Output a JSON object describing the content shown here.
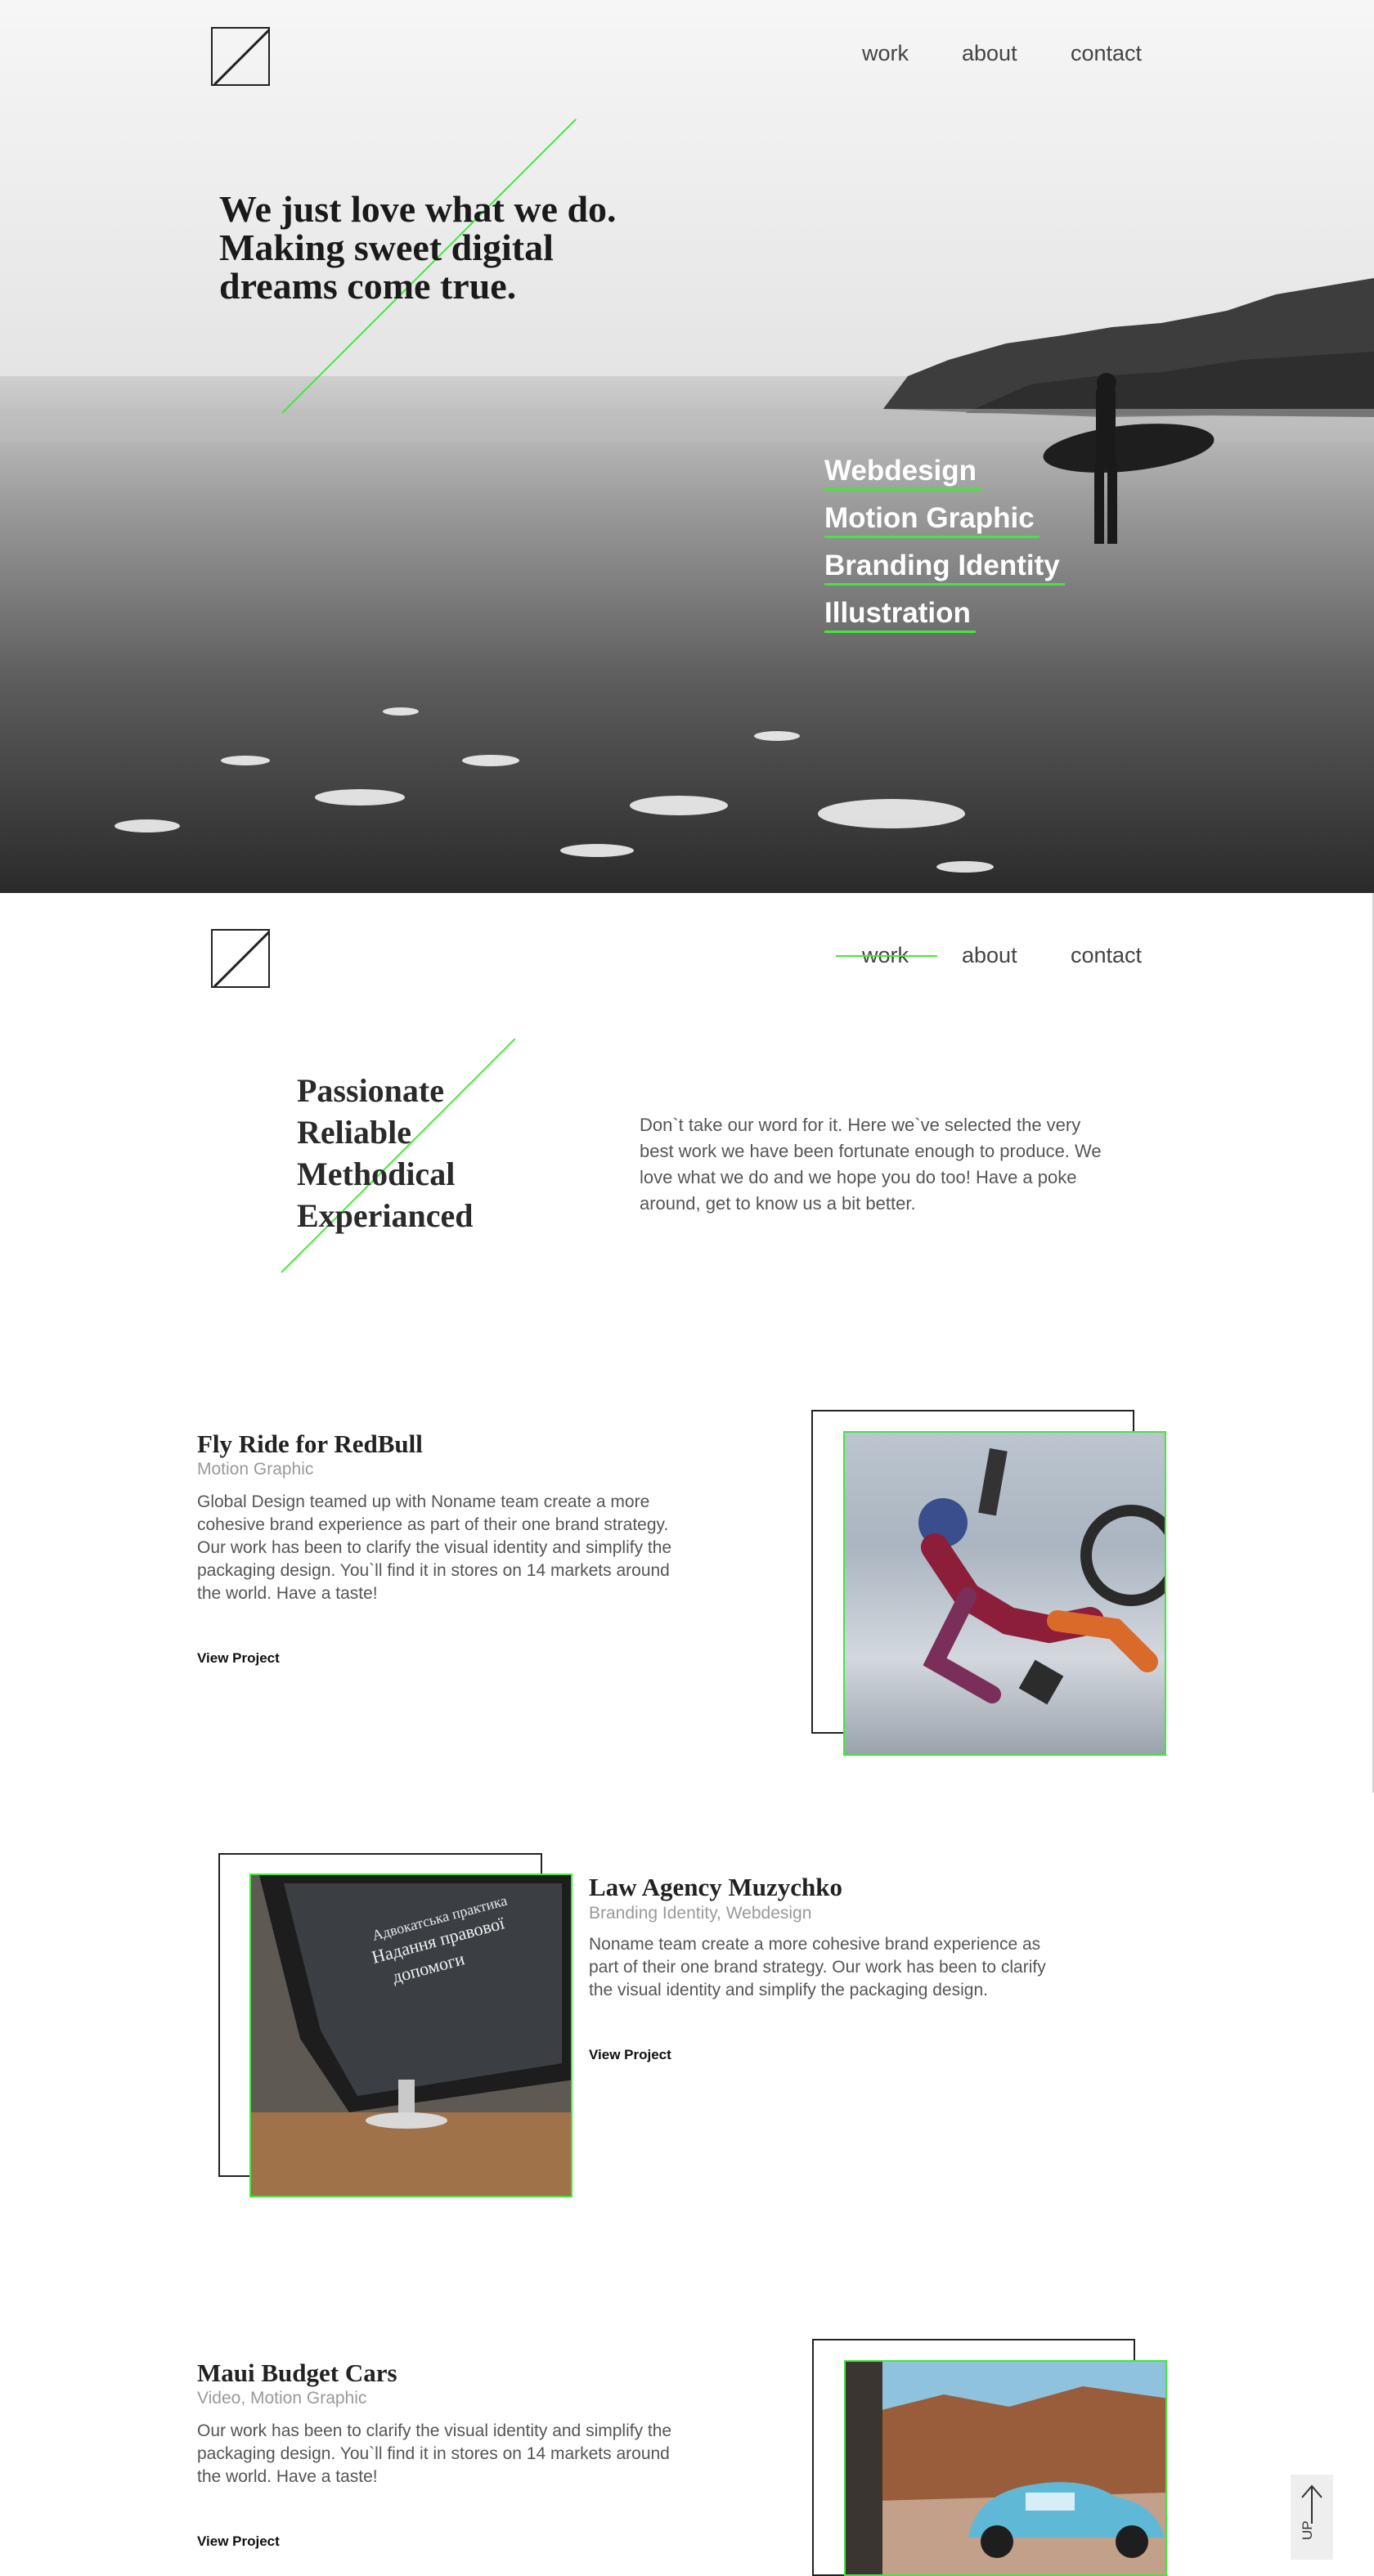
{
  "nav": {
    "work": "work",
    "about": "about",
    "contact": "contact"
  },
  "hero": {
    "title_lines": [
      "We just love what we do.",
      "Making sweet digital",
      "dreams come true."
    ],
    "services": [
      "Webdesign",
      "Motion Graphic",
      "Branding Identity",
      "Illustration"
    ]
  },
  "about": {
    "tagline_lines": [
      "Passionate",
      "Reliable",
      "Methodical",
      "Experianced"
    ],
    "intro": "Don`t take our word for it. Here we`ve selected the very best work we have been fortunate enough to produce. We love what we do and we hope you do too! Have a poke around, get to know us a bit better."
  },
  "projects": [
    {
      "title": "Fly Ride for RedBull",
      "category": "Motion Graphic",
      "description": "Global Design teamed up with Noname team create a more cohesive brand experience as part of their one brand strategy. Our work has been to clarify the visual identity and simplify the packaging design. You`ll find it in stores on 14 markets around the world. Have a taste!",
      "link": "View Project"
    },
    {
      "title": "Law Agency Muzychko",
      "category": "Branding Identity, Webdesign",
      "description": "Noname team create a more cohesive brand experience as part of their one brand strategy. Our work has been to clarify the visual identity and simplify the packaging design.",
      "link": "View Project"
    },
    {
      "title": "Maui Budget Cars",
      "category": "Video, Motion Graphic",
      "description": "Our work has been to clarify the visual identity and simplify the packaging design. You`ll find it in stores on 14 markets around the world. Have a taste!",
      "link": "View Project"
    }
  ],
  "law_screen_text": [
    "Адвокатська практика",
    "Надання правової",
    "допомоги"
  ],
  "up_button": "UP",
  "colors": {
    "accent_green": "#45e63c",
    "text_dark": "#222222",
    "text_muted": "#9a9a9a"
  }
}
